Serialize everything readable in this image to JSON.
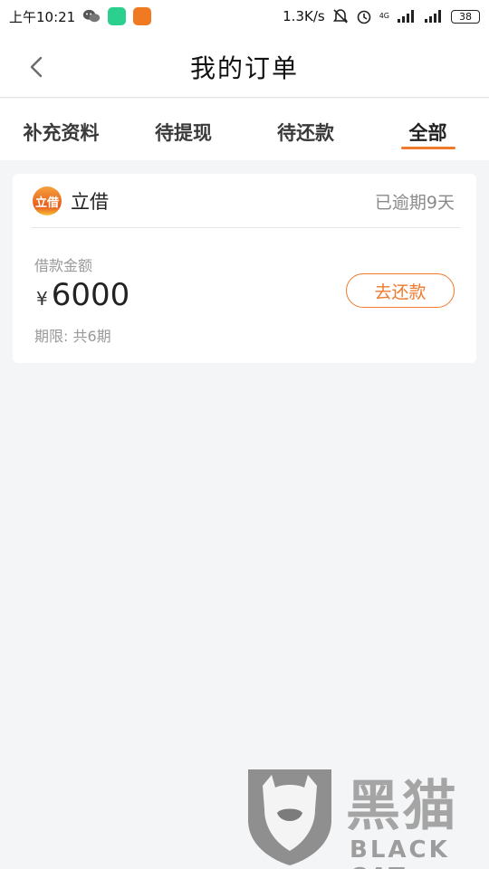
{
  "status_bar": {
    "time": "上午10:21",
    "network_speed": "1.3K/s",
    "network_type": "4G",
    "battery": "38",
    "app_icon_colors": [
      "#2bcf8e",
      "#f07a22"
    ]
  },
  "header": {
    "title": "我的订单"
  },
  "tabs": [
    {
      "label": "补充资料",
      "active": false
    },
    {
      "label": "待提现",
      "active": false
    },
    {
      "label": "待还款",
      "active": false
    },
    {
      "label": "全部",
      "active": true
    }
  ],
  "order_card": {
    "brand_logo_text": "立借",
    "brand_name": "立借",
    "status": "已逾期9天",
    "amount_label": "借款金额",
    "currency_symbol": "¥",
    "amount": "6000",
    "term": "期限: 共6期",
    "action_label": "去还款"
  },
  "colors": {
    "accent": "#ef7a2e",
    "background": "#f4f5f7"
  },
  "watermark": {
    "title": "黑猫",
    "subtitle": "BLACK CAT"
  }
}
